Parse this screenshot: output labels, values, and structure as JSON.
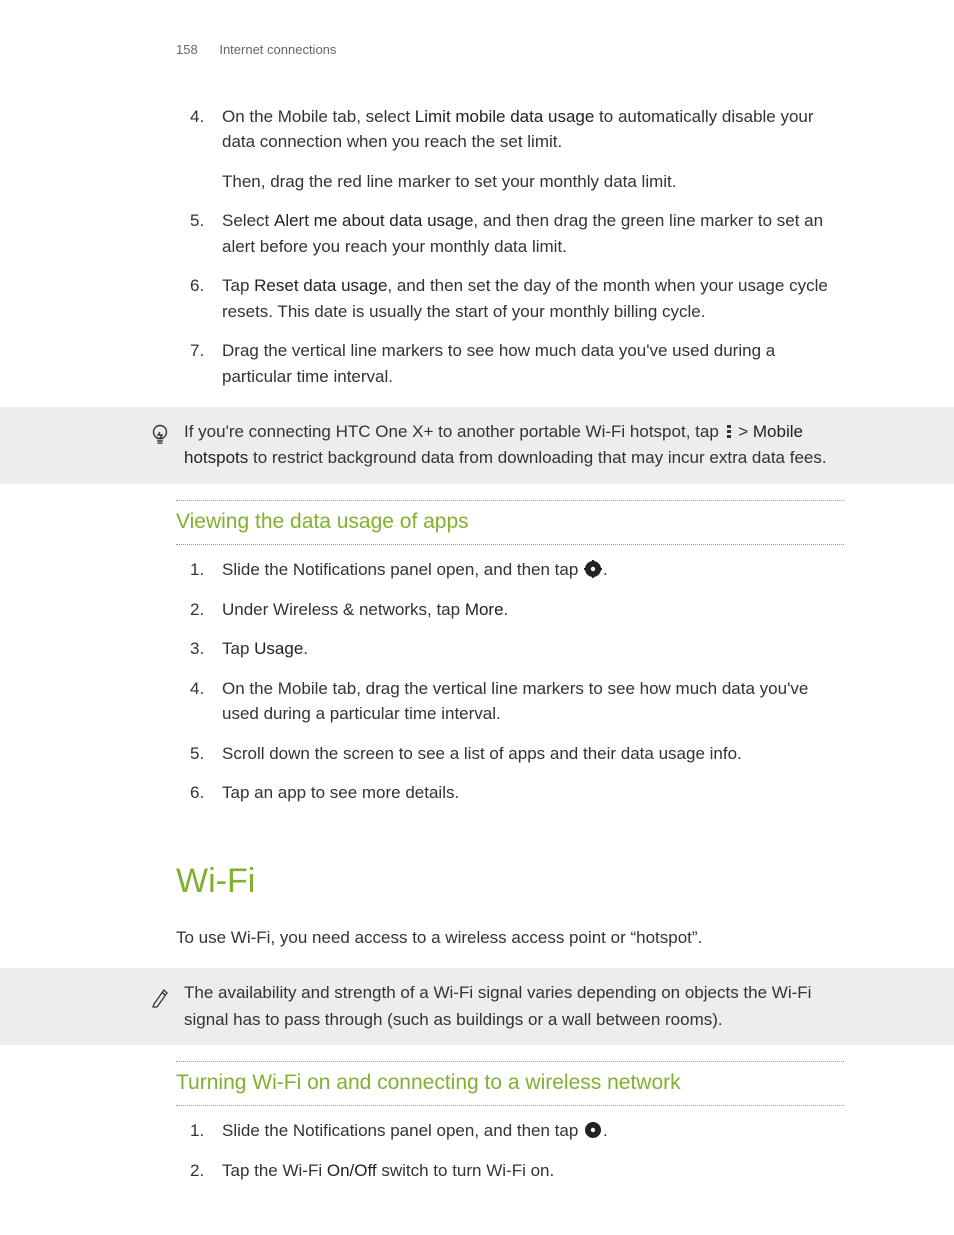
{
  "header": {
    "page_number": "158",
    "section_name": "Internet connections"
  },
  "steps_a": {
    "4": {
      "pre": "On the Mobile tab, select ",
      "bold": "Limit mobile data usage",
      "post": " to automatically disable your data connection when you reach the set limit.",
      "sub": "Then, drag the red line marker to set your monthly data limit."
    },
    "5": {
      "pre": "Select ",
      "bold": "Alert me about data usage",
      "post": ", and then drag the green line marker to set an alert before you reach your monthly data limit."
    },
    "6": {
      "pre": "Tap ",
      "bold": "Reset data usage",
      "post": ", and then set the day of the month when your usage cycle resets. This date is usually the start of your monthly billing cycle."
    },
    "7": {
      "text": "Drag the vertical line markers to see how much data you've used during a particular time interval."
    }
  },
  "tip": {
    "pre": "If you're connecting HTC One X+ to another portable Wi-Fi hotspot, tap ",
    "sep": " > ",
    "bold": "Mobile hotspots",
    "post": " to restrict background data from downloading that may incur extra data fees."
  },
  "section_b": {
    "title": "Viewing the data usage of apps",
    "steps": {
      "1": {
        "pre": "Slide the Notifications panel open, and then tap ",
        "post": "."
      },
      "2": {
        "pre": "Under Wireless & networks, tap ",
        "bold": "More",
        "post": "."
      },
      "3": {
        "pre": "Tap ",
        "bold": "Usage",
        "post": "."
      },
      "4": {
        "text": "On the Mobile tab, drag the vertical line markers to see how much data you've used during a particular time interval."
      },
      "5": {
        "text": "Scroll down the screen to see a list of apps and their data usage info."
      },
      "6": {
        "text": "Tap an app to see more details."
      }
    }
  },
  "wifi": {
    "heading": "Wi-Fi",
    "intro": "To use Wi-Fi, you need access to a wireless access point or “hotspot”.",
    "note": "The availability and strength of a Wi-Fi signal varies depending on objects the Wi-Fi signal has to pass through (such as buildings or a wall between rooms).",
    "section_title": "Turning Wi-Fi on and connecting to a wireless network",
    "steps": {
      "1": {
        "pre": "Slide the Notifications panel open, and then tap ",
        "post": "."
      },
      "2": {
        "pre": "Tap the Wi-Fi ",
        "bold": "On/Off",
        "post": " switch to turn Wi-Fi on."
      }
    }
  }
}
